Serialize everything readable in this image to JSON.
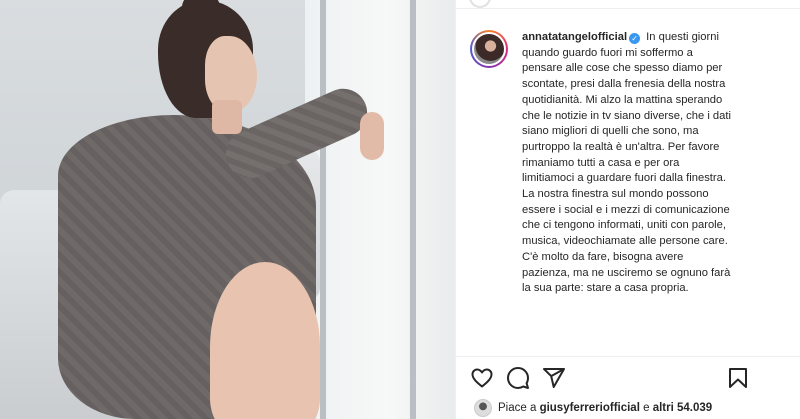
{
  "post": {
    "username": "annatatangelofficial",
    "verified_mark": "✓",
    "caption": "In questi giorni quando guardo fuori mi soffermo a pensare alle cose che spesso diamo per scontate, presi dalla frenesia della nostra quotidianità. Mi alzo la mattina sperando che le notizie in tv siano diverse, che i dati siano migliori di quelli che sono, ma purtroppo la realtà è un'altra. Per favore rimaniamo tutti a casa e per ora limitiamoci a guardare fuori dalla finestra. La nostra finestra sul mondo possono essere i social e i mezzi di comunicazione che ci tengono informati, uniti con parole, musica, videochiamate alle persone care. C'è molto da fare, bisogna avere pazienza, ma ne usciremo se ognuno farà la sua parte: stare a casa propria."
  },
  "actions": {
    "like_icon": "heart-icon",
    "comment_icon": "comment-icon",
    "share_icon": "share-icon",
    "save_icon": "bookmark-icon"
  },
  "likes": {
    "prefix": "Piace a ",
    "user": "giusyferreriofficial",
    "middle": " e ",
    "others": "altri 54.039"
  },
  "colors": {
    "text": "#262626",
    "verified": "#3897f0",
    "border": "#efefef"
  }
}
